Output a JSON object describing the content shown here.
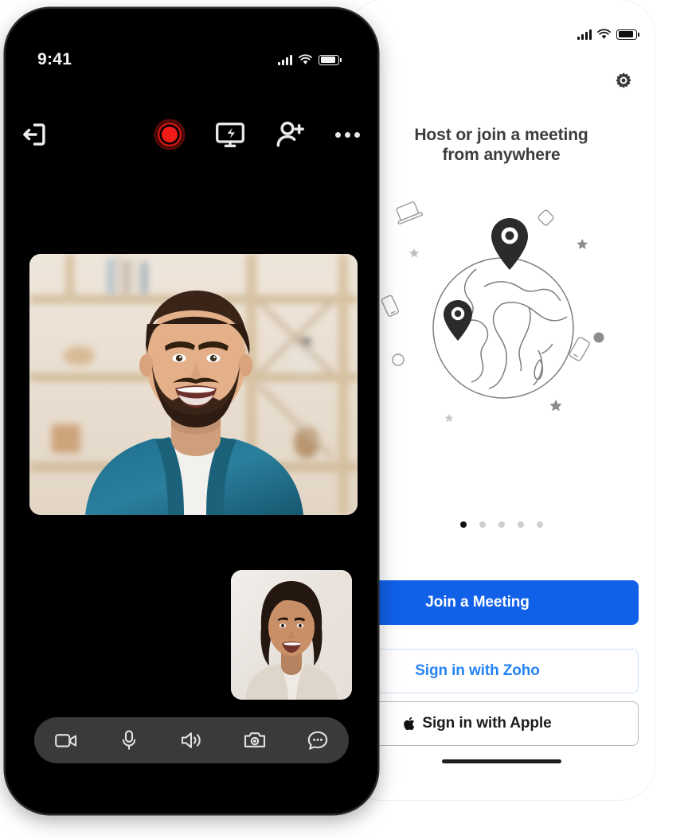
{
  "left_phone": {
    "status": {
      "time": "9:41",
      "signal_icon": "cellular-signal-icon",
      "wifi_icon": "wifi-icon",
      "battery_icon": "battery-icon"
    },
    "toolbar": {
      "exit_icon": "exit-meeting-icon",
      "record_icon": "record-icon",
      "share_screen_icon": "share-screen-icon",
      "add_participant_icon": "add-participant-icon",
      "more_icon": "more-options-icon"
    },
    "main_video": {
      "name": "main-video-feed",
      "description": "smiling bearded man in teal shirt"
    },
    "pip_video": {
      "name": "self-view-video",
      "description": "smiling woman with dark hair in light top"
    },
    "controls": [
      {
        "name": "video-toggle-button",
        "icon": "video-camera-icon"
      },
      {
        "name": "mic-toggle-button",
        "icon": "microphone-icon"
      },
      {
        "name": "speaker-toggle-button",
        "icon": "speaker-icon"
      },
      {
        "name": "flip-camera-button",
        "icon": "camera-icon"
      },
      {
        "name": "chat-button",
        "icon": "chat-bubble-icon"
      }
    ]
  },
  "right_phone": {
    "status": {
      "time_clipped": "0",
      "signal_icon": "cellular-signal-icon",
      "wifi_icon": "wifi-icon",
      "battery_icon": "battery-icon"
    },
    "settings_icon": "gear-icon",
    "heading_line1": "Host or join a meeting",
    "heading_line2": "from anywhere",
    "illustration": {
      "name": "globe-illustration",
      "description": "outlined globe with two location pins surrounded by devices and stars"
    },
    "pagination": {
      "total": 5,
      "active_index": 0
    },
    "buttons": {
      "join_label": "Join a Meeting",
      "zoho_label": "Sign in with Zoho",
      "apple_label": "Sign in with Apple",
      "apple_glyph": ""
    },
    "home_indicator": "home-indicator"
  },
  "colors": {
    "primary_blue": "#1160e8",
    "link_blue": "#2683f5",
    "record_red": "#ef1b16",
    "dark_bezel": "#0a0a0a",
    "control_bar": "#3a3a3a"
  }
}
